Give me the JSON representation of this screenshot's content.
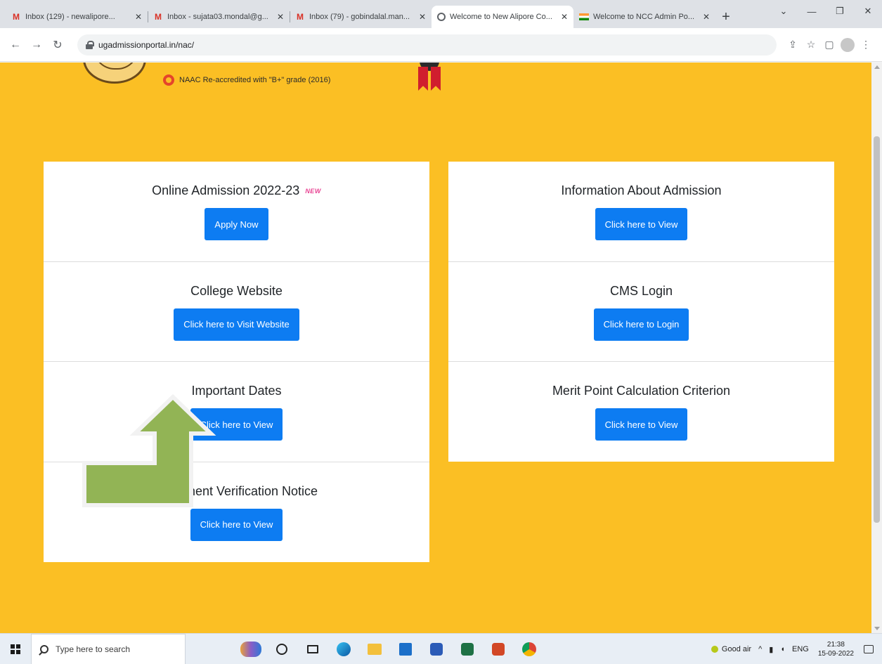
{
  "browser": {
    "tabs": [
      {
        "title": "Inbox (129) - newalipore...",
        "icon": "gmail-icon",
        "active": false
      },
      {
        "title": "Inbox - sujata03.mondal@g...",
        "icon": "gmail-icon",
        "active": false
      },
      {
        "title": "Inbox (79) - gobindalal.man...",
        "icon": "gmail-icon",
        "active": false
      },
      {
        "title": "Welcome to New Alipore Co...",
        "icon": "globe-icon",
        "active": true
      },
      {
        "title": "Welcome to NCC Admin Po...",
        "icon": "flag-icon",
        "active": false
      }
    ],
    "new_tab": "+",
    "url": "ugadmissionportal.in/nac/"
  },
  "page": {
    "naac_text": "NAAC Re-accredited with \"B+\" grade (2016)",
    "left_sections": [
      {
        "heading": "Online Admission 2022-23",
        "badge": "NEW",
        "button": "Apply Now"
      },
      {
        "heading": "College Website",
        "button": "Click here to Visit Website"
      },
      {
        "heading": "Important Dates",
        "button": "Click here to View"
      },
      {
        "heading": "Document Verification Notice",
        "button": "Click here to View"
      }
    ],
    "right_sections": [
      {
        "heading": "Information About Admission",
        "button": "Click here to View"
      },
      {
        "heading": "CMS Login",
        "button": "Click here to Login"
      },
      {
        "heading": "Merit Point Calculation Criterion",
        "button": "Click here to View"
      }
    ],
    "colors": {
      "background": "#fbbf24",
      "button": "#0d7cf2",
      "arrow": "#92b455"
    }
  },
  "taskbar": {
    "search_placeholder": "Type here to search",
    "weather": "Good air",
    "language": "ENG",
    "time": "21:38",
    "date": "15-09-2022"
  }
}
